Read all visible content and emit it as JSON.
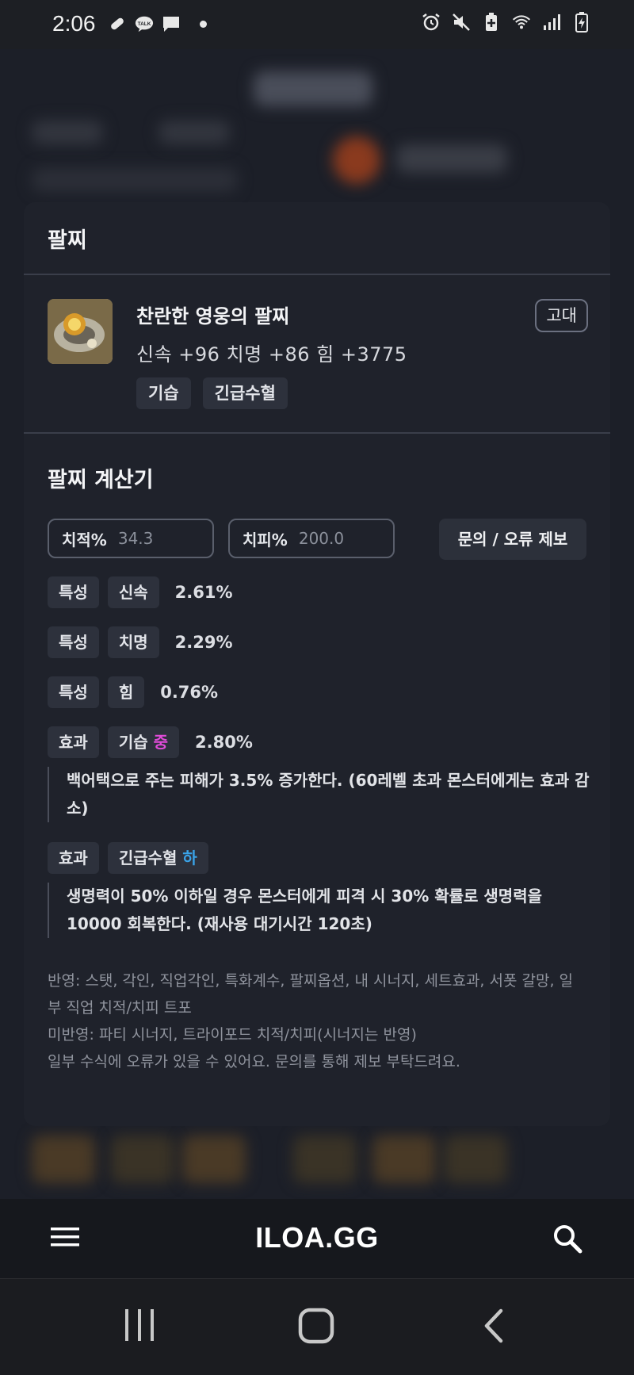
{
  "status_bar": {
    "time": "2:06",
    "left_icons": [
      "bandage-icon",
      "kakaotalk-icon",
      "chat-icon",
      "dot-icon"
    ],
    "right_icons": [
      "alarm-icon",
      "mute-icon",
      "battery-saver-icon",
      "wifi-icon",
      "signal-icon",
      "battery-icon"
    ]
  },
  "modal": {
    "title": "팔찌",
    "item": {
      "name": "찬란한 영웅의 팔찌",
      "grade": "고대",
      "stats": "신속 +96  치명 +86  힘 +3775",
      "tags": [
        "기습",
        "긴급수혈"
      ]
    },
    "calculator": {
      "title": "팔찌 계산기",
      "crit_rate": {
        "label": "치적%",
        "value": "34.3"
      },
      "crit_damage": {
        "label": "치피%",
        "value": "200.0"
      },
      "report_button": "문의 / 오류 제보",
      "rows": [
        {
          "type": "특성",
          "name": "신속",
          "value": "2.61%"
        },
        {
          "type": "특성",
          "name": "치명",
          "value": "2.29%"
        },
        {
          "type": "특성",
          "name": "힘",
          "value": "0.76%"
        },
        {
          "type": "효과",
          "name": "기습",
          "level": "중",
          "value": "2.80%",
          "desc": "백어택으로 주는 피해가 3.5% 증가한다. (60레벨 초과 몬스터에게는 효과 감소)"
        },
        {
          "type": "효과",
          "name": "긴급수혈",
          "level": "하",
          "value": "",
          "desc": "생명력이 50% 이하일 경우 몬스터에게 피격 시 30% 확률로 생명력을 10000 회복한다. (재사용 대기시간 120초)"
        }
      ],
      "notes": [
        "반영: 스탯, 각인, 직업각인, 특화계수, 팔찌옵션, 내 시너지, 세트효과, 서폿 갈망, 일부 직업 치적/치피 트포",
        "미반영: 파티 시너지, 트라이포드 치적/치피(시너지는 반영)",
        "일부 수식에 오류가 있을 수 있어요. 문의를 통해 제보 부탁드려요."
      ]
    }
  },
  "navbar": {
    "logo": "ILOA.GG"
  },
  "colors": {
    "mid_level": "#e14bd9",
    "low_level": "#3aa3e8",
    "card_bg": "#1f222b"
  }
}
